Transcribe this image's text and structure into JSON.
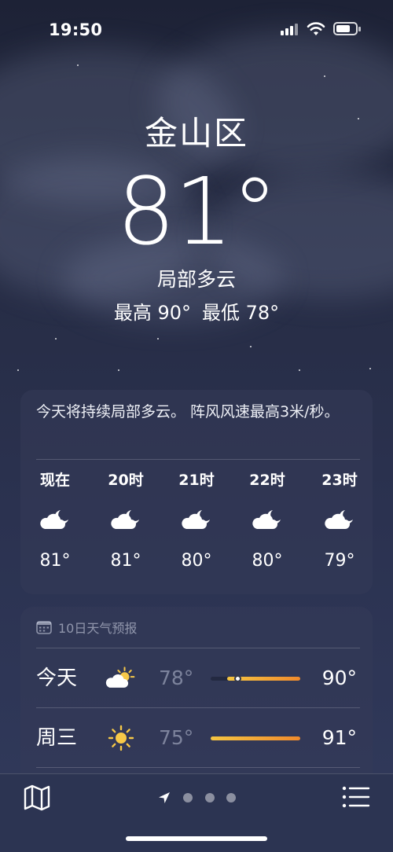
{
  "status_bar": {
    "time": "19:50"
  },
  "location": {
    "city": "金山区",
    "temperature": "81°",
    "condition": "局部多云",
    "high": "最高 90°",
    "low": "最低 78°"
  },
  "hourly_card": {
    "summary": "今天将持续局部多云。 阵风风速最高3米/秒。",
    "hours": [
      {
        "label": "现在",
        "icon": "partly-cloudy-night-icon",
        "temp": "81°"
      },
      {
        "label": "20时",
        "icon": "partly-cloudy-night-icon",
        "temp": "81°"
      },
      {
        "label": "21时",
        "icon": "partly-cloudy-night-icon",
        "temp": "80°"
      },
      {
        "label": "22时",
        "icon": "partly-cloudy-night-icon",
        "temp": "80°"
      },
      {
        "label": "23时",
        "icon": "partly-cloudy-night-icon",
        "temp": "79°"
      }
    ]
  },
  "daily_card": {
    "header": "10日天气预报",
    "header_icon": "calendar-icon",
    "days": [
      {
        "day": "今天",
        "icon": "partly-sunny-icon",
        "low": "78°",
        "high": "90°",
        "range_start": 0.18,
        "range_end": 1.0,
        "current_pos": 0.3,
        "bar_color": "#f08a2c"
      },
      {
        "day": "周三",
        "icon": "sun-icon",
        "low": "75°",
        "high": "91°",
        "range_start": 0.0,
        "range_end": 1.0,
        "bar_color": "#f08a2c"
      }
    ]
  },
  "tab_bar": {
    "map_icon": "map-icon",
    "location_icon": "location-arrow-icon",
    "page_count": 3,
    "list_icon": "list-icon"
  },
  "colors": {
    "accent_orange": "#f08a2c",
    "accent_yellow": "#f5c542",
    "sun_yellow": "#f7c948"
  }
}
